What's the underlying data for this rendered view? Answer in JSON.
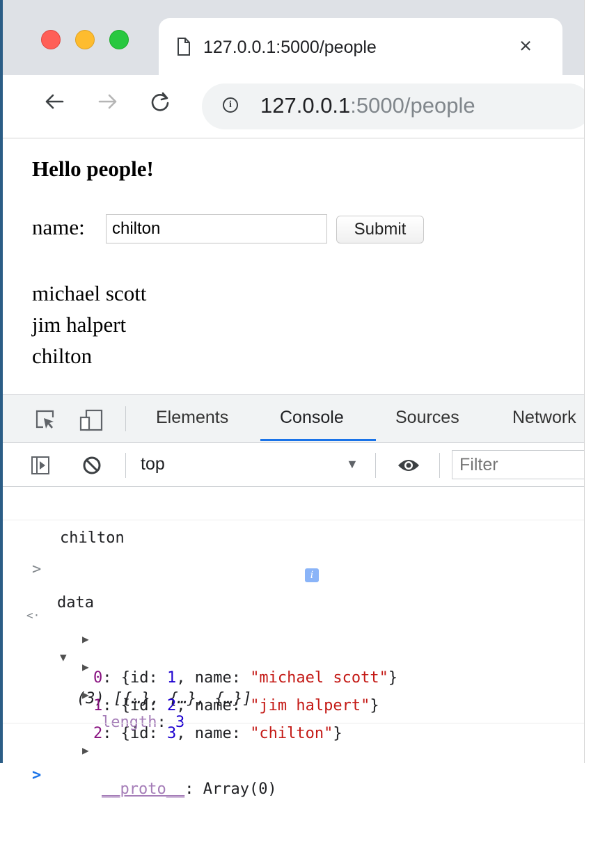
{
  "browser": {
    "tab_title": "127.0.0.1:5000/people",
    "tab_close": "×",
    "url_host": "127.0.0.1",
    "url_rest": ":5000/people",
    "info_glyph": "i",
    "icons": [
      "page-icon",
      "back-arrow-icon",
      "forward-arrow-icon",
      "reload-icon",
      "info-icon",
      "close-icon"
    ]
  },
  "page": {
    "heading": "Hello people!",
    "name_label": "name:",
    "name_value": "chilton",
    "submit_label": "Submit",
    "people": [
      "michael scott",
      "jim halpert",
      "chilton"
    ]
  },
  "devtools": {
    "tabs": [
      "Elements",
      "Console",
      "Sources",
      "Network"
    ],
    "active_tab": "Console",
    "context": "top",
    "context_arrow": "▼",
    "filter_placeholder": "Filter",
    "accent_color": "#1a73e8",
    "console": {
      "log_output": "chilton",
      "prompt_symbol": ">",
      "result_symbol": "<·",
      "command": "data",
      "array_summary": "(3) [{…}, {…}, {…}]",
      "info_badge": "i",
      "items": [
        {
          "index": "0",
          "id": "1",
          "name": "\"michael scott\""
        },
        {
          "index": "1",
          "id": "2",
          "name": "\"jim halpert\""
        },
        {
          "index": "2",
          "id": "3",
          "name": "\"chilton\""
        }
      ],
      "length_key": "length",
      "length_value": "3",
      "proto_key": "__proto__",
      "proto_value": "Array(0)",
      "input_prompt": ">"
    }
  }
}
